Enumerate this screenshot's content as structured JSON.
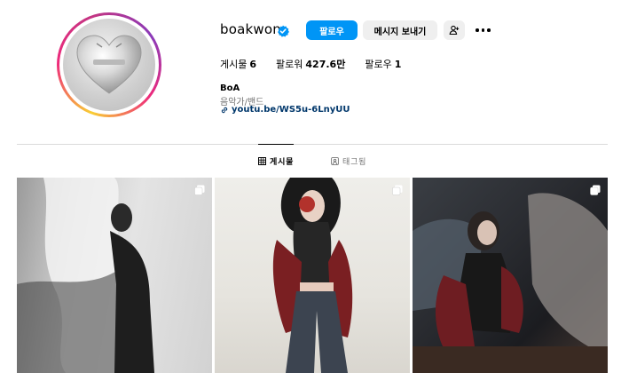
{
  "profile": {
    "username": "boakwon",
    "verified_icon": "verified-badge-icon",
    "buttons": {
      "follow": "팔로우",
      "message": "메시지 보내기",
      "suggest_icon": "add-person-icon",
      "more_icon": "more-options-icon"
    },
    "stats": {
      "posts_label": "게시물",
      "posts_value": "6",
      "followers_label": "팔로워",
      "followers_value": "427.6만",
      "following_label": "팔로우",
      "following_value": "1"
    },
    "bio": {
      "name": "BoA",
      "category": "음악가/밴드",
      "link": "youtu.be/WS5u-6LnyUU",
      "link_icon": "link-icon"
    }
  },
  "tabs": [
    {
      "label": "게시물",
      "icon": "grid-icon",
      "active": true
    },
    {
      "label": "태그됨",
      "icon": "tagged-icon",
      "active": false
    }
  ],
  "posts": [
    {
      "type": "carousel",
      "icon": "multiple-posts-icon"
    },
    {
      "type": "carousel",
      "icon": "multiple-posts-icon"
    },
    {
      "type": "carousel",
      "icon": "multiple-posts-icon"
    }
  ],
  "colors": {
    "accent": "#0095f6",
    "secondary_button": "#efefef",
    "muted_text": "#737373",
    "link_text": "#00376b"
  }
}
